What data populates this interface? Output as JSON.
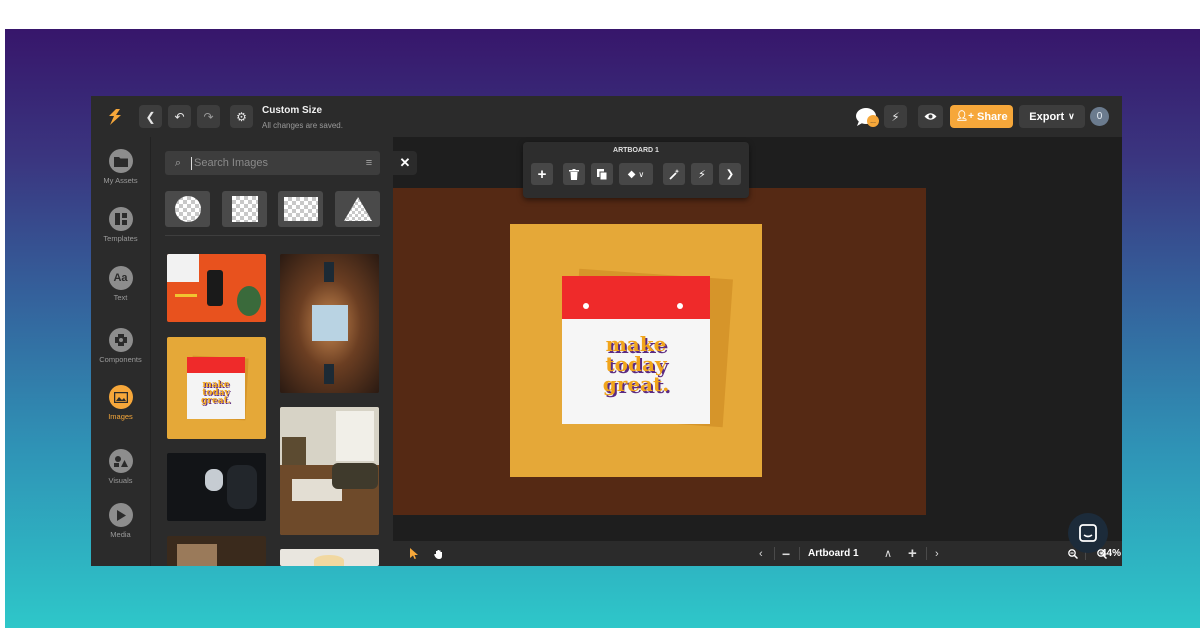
{
  "header": {
    "doc_title": "Custom Size",
    "doc_status": "All changes are saved.",
    "share_label": "Share",
    "export_label": "Export",
    "avatar_initial": "0"
  },
  "sidebar": {
    "items": [
      {
        "label": "My Assets",
        "icon": "folder-icon"
      },
      {
        "label": "Templates",
        "icon": "templates-icon"
      },
      {
        "label": "Text",
        "icon": "text-icon",
        "glyph": "Aa"
      },
      {
        "label": "Components",
        "icon": "components-icon"
      },
      {
        "label": "Images",
        "icon": "image-icon",
        "active": true
      },
      {
        "label": "Visuals",
        "icon": "visuals-icon"
      },
      {
        "label": "Media",
        "icon": "play-icon"
      }
    ]
  },
  "image_panel": {
    "search_placeholder": "Search Images",
    "shape_tiles": [
      "circle",
      "square",
      "rectangle",
      "triangle"
    ]
  },
  "canvas": {
    "toolbar_title": "ARTBOARD 1",
    "calendar_text": [
      "make",
      "today",
      "great."
    ],
    "artboard_color": "#e5a838",
    "board_color": "#552914"
  },
  "bottom_bar": {
    "artboard_label": "Artboard 1",
    "zoom": "44%"
  },
  "colors": {
    "accent": "#f6a73a",
    "calendar_red": "#ef2a2a"
  }
}
